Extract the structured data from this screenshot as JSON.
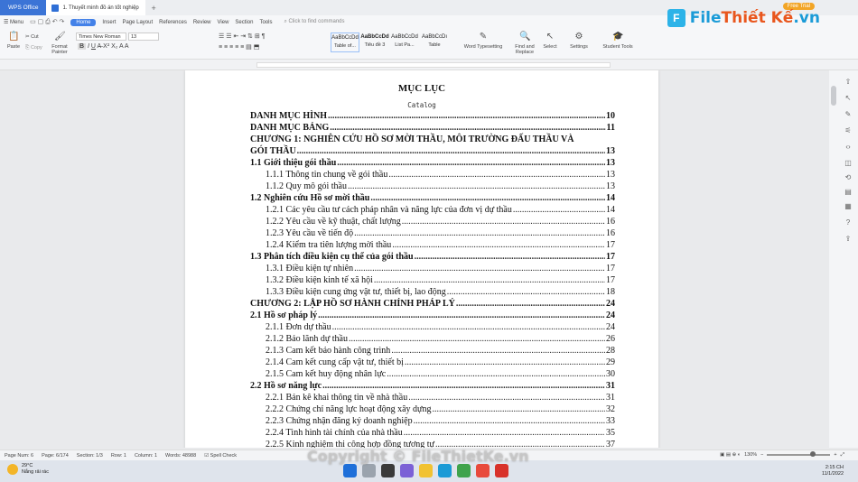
{
  "titlebar": {
    "app_label": "WPS Office",
    "doc_tab": "1. Thuyết minh đồ án tốt nghiệp",
    "new_tab": "+"
  },
  "brand": {
    "logo_text_a": "File",
    "logo_text_b": "Thiết Kế",
    "logo_text_c": ".vn",
    "trial": "Free Trial"
  },
  "menu": {
    "menu_label": "Menu",
    "items": [
      "Home",
      "Insert",
      "Page Layout",
      "References",
      "Review",
      "View",
      "Section",
      "Tools"
    ],
    "search_placeholder": "Click to find commands"
  },
  "ribbon": {
    "paste": "Paste",
    "cut": "Cut",
    "copy": "Copy",
    "format_painter": "Format Painter",
    "font_name": "Times New Roman",
    "font_size": "13",
    "styles": [
      {
        "preview": "AaBbCcDd",
        "name": "Table of..."
      },
      {
        "preview": "AaBbCcDd",
        "name": "Tiêu đề 3"
      },
      {
        "preview": "AaBbCcDd",
        "name": "List Pa..."
      },
      {
        "preview": "AaBbCcDı",
        "name": "Table"
      }
    ],
    "word_typesetting": "Word Typesetting",
    "find_replace": "Find and Replace",
    "select": "Select",
    "settings": "Settings",
    "student_tools": "Student Tools"
  },
  "document": {
    "title": "MỤC LỤC",
    "subtitle": "Catalog",
    "entries": [
      {
        "text": "DANH MỤC HÌNH",
        "page": "10",
        "level": 1
      },
      {
        "text": "DANH MỤC BẢNG",
        "page": "11",
        "level": 1
      },
      {
        "text": "CHƯƠNG 1: NGHIÊN CỨU HỒ SƠ MỜI THẦU, MÔI TRƯỜNG ĐẤU THẦU VÀ",
        "page": "",
        "level": 1
      },
      {
        "text": "GÓI THẦU",
        "page": "13",
        "level": 1
      },
      {
        "text": "1.1 Giới thiệu gói thầu",
        "page": "13",
        "level": 1
      },
      {
        "text": "1.1.1 Thông tin chung về gói thầu",
        "page": "13",
        "level": 3
      },
      {
        "text": "1.1.2 Quy mô gói thầu",
        "page": "13",
        "level": 3
      },
      {
        "text": "1.2 Nghiên cứu Hồ sơ mời thầu",
        "page": "14",
        "level": 1
      },
      {
        "text": "1.2.1 Các yêu cầu tư cách pháp nhân và năng lực của đơn vị dự thầu",
        "page": "14",
        "level": 3
      },
      {
        "text": "1.2.2 Yêu cầu về kỹ thuật, chất lượng",
        "page": "16",
        "level": 3
      },
      {
        "text": "1.2.3 Yêu cầu về tiến độ",
        "page": "16",
        "level": 3
      },
      {
        "text": "1.2.4 Kiểm tra tiên lượng mời thầu",
        "page": "17",
        "level": 3
      },
      {
        "text": "1.3 Phân tích điều kiện cụ thể của gói thầu",
        "page": "17",
        "level": 1
      },
      {
        "text": "1.3.1 Điều kiện tự nhiên",
        "page": "17",
        "level": 3
      },
      {
        "text": "1.3.2 Điều kiện kinh tế xã hội",
        "page": "17",
        "level": 3
      },
      {
        "text": "1.3.3 Điều kiện cung ứng vật tư, thiết bị, lao động",
        "page": "18",
        "level": 3
      },
      {
        "text": "CHƯƠNG 2: LẬP HỒ SƠ HÀNH CHÍNH PHÁP LÝ",
        "page": "24",
        "level": 1
      },
      {
        "text": "2.1 Hồ sơ pháp lý",
        "page": "24",
        "level": 1
      },
      {
        "text": "2.1.1 Đơn dự thầu",
        "page": "24",
        "level": 3
      },
      {
        "text": "2.1.2 Bảo lãnh dự thầu",
        "page": "26",
        "level": 3
      },
      {
        "text": "2.1.3 Cam kết bảo hành công trình",
        "page": "28",
        "level": 3
      },
      {
        "text": "2.1.4 Cam kết cung cấp vật tư, thiết bị",
        "page": "29",
        "level": 3
      },
      {
        "text": "2.1.5 Cam kết huy động nhân lực",
        "page": "30",
        "level": 3
      },
      {
        "text": "2.2 Hồ sơ năng lực",
        "page": "31",
        "level": 1
      },
      {
        "text": "2.2.1 Bản kê khai thông tin về nhà thầu",
        "page": "31",
        "level": 3
      },
      {
        "text": "2.2.2 Chứng chỉ năng lực hoạt động xây dựng",
        "page": "32",
        "level": 3
      },
      {
        "text": "2.2.3 Chứng nhận đăng ký doanh nghiệp",
        "page": "33",
        "level": 3
      },
      {
        "text": "2.2.4 Tình hình tài chính của nhà thầu",
        "page": "35",
        "level": 3
      },
      {
        "text": "2.2.5 Kinh nghiệm thi công hợp đồng tương tự",
        "page": "37",
        "level": 3
      }
    ]
  },
  "status": {
    "page_no": "Page Num: 6",
    "page": "Page: 6/174",
    "section": "Section: 1/3",
    "row": "Row: 1",
    "column": "Column: 1",
    "words": "Words: 48988",
    "spell": "Spell Check",
    "zoom": "130%"
  },
  "taskbar": {
    "temp": "29°C",
    "weather": "Nắng rải rác",
    "time": "2:15 CH",
    "date": "11/1/2022"
  },
  "watermark": "Copyright © FileThietKe.vn",
  "colors": {
    "accent": "#4381e8",
    "brand_blue": "#1b9bd7",
    "brand_orange": "#e9561d"
  }
}
